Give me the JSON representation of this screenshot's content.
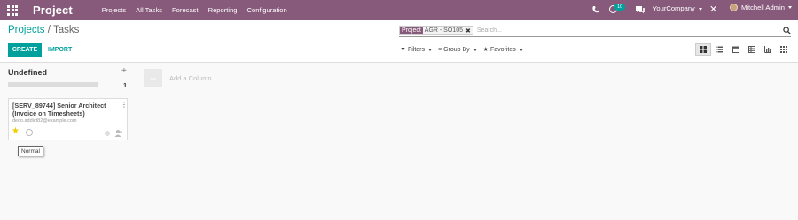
{
  "navbar": {
    "app_name": "Project",
    "menu": [
      "Projects",
      "All Tasks",
      "Forecast",
      "Reporting",
      "Configuration"
    ],
    "activity_count": "10",
    "company": "YourCompany",
    "user": "Mitchell Admin",
    "icons": [
      "apps-grid-icon",
      "phone-icon",
      "clock-icon",
      "chat-icon",
      "close-icon"
    ]
  },
  "breadcrumb": {
    "parent": "Projects",
    "separator": "/",
    "current": "Tasks"
  },
  "buttons": {
    "create": "CREATE",
    "import": "IMPORT"
  },
  "search": {
    "facet_label": "Project",
    "facet_value": "AGR - SO105",
    "facet_remove": "✖",
    "placeholder": "Search..."
  },
  "filters": {
    "filters": "Filters",
    "group_by": "Group By",
    "favorites": "Favorites"
  },
  "views": [
    "kanban",
    "list",
    "calendar",
    "pivot",
    "graph",
    "activity"
  ],
  "kanban": {
    "column": {
      "title": "Undefined",
      "count": "1"
    },
    "card": {
      "title": "[SERV_89744] Senior Architect (Invoice on Timesheets)",
      "email": "deco.addict82@example.com",
      "menu": "⋮",
      "star": "★"
    },
    "tooltip": "Normal",
    "add_column": "Add a Column"
  },
  "colors": {
    "brand": "#875a7b",
    "accent": "#00a09d",
    "star": "#f3cc00"
  }
}
